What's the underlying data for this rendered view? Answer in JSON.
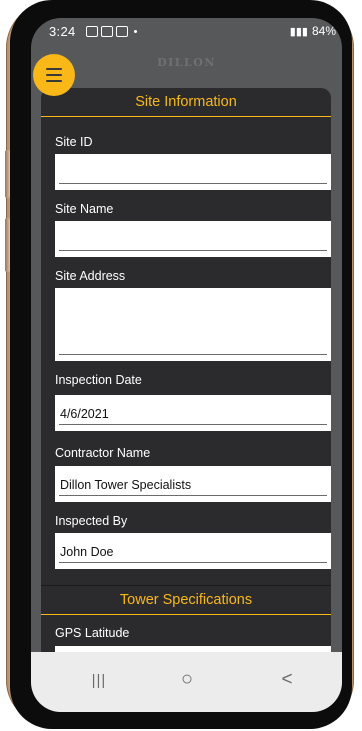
{
  "status_bar": {
    "time": "3:24",
    "battery": "84%"
  },
  "brand": "DILLON",
  "menu": {
    "icon": "hamburger-menu-icon"
  },
  "sections": {
    "site_info": "Site Information",
    "tower_specs": "Tower Specifications"
  },
  "fields": {
    "site_id": {
      "label": "Site ID",
      "value": ""
    },
    "site_name": {
      "label": "Site Name",
      "value": ""
    },
    "site_address": {
      "label": "Site Address",
      "value": ""
    },
    "inspection_date": {
      "label": "Inspection Date",
      "value": "4/6/2021"
    },
    "contractor_name": {
      "label": "Contractor Name",
      "value": "Dillon Tower Specialists"
    },
    "inspected_by": {
      "label": "Inspected By",
      "value": "John Doe"
    },
    "gps_latitude": {
      "label": "GPS Latitude",
      "value": ""
    }
  },
  "nav": {
    "recents": "|||",
    "home": "○",
    "back": "<"
  },
  "colors": {
    "accent": "#f9b718",
    "panel": "#2b2b2d",
    "screen_bg": "#57585a"
  }
}
